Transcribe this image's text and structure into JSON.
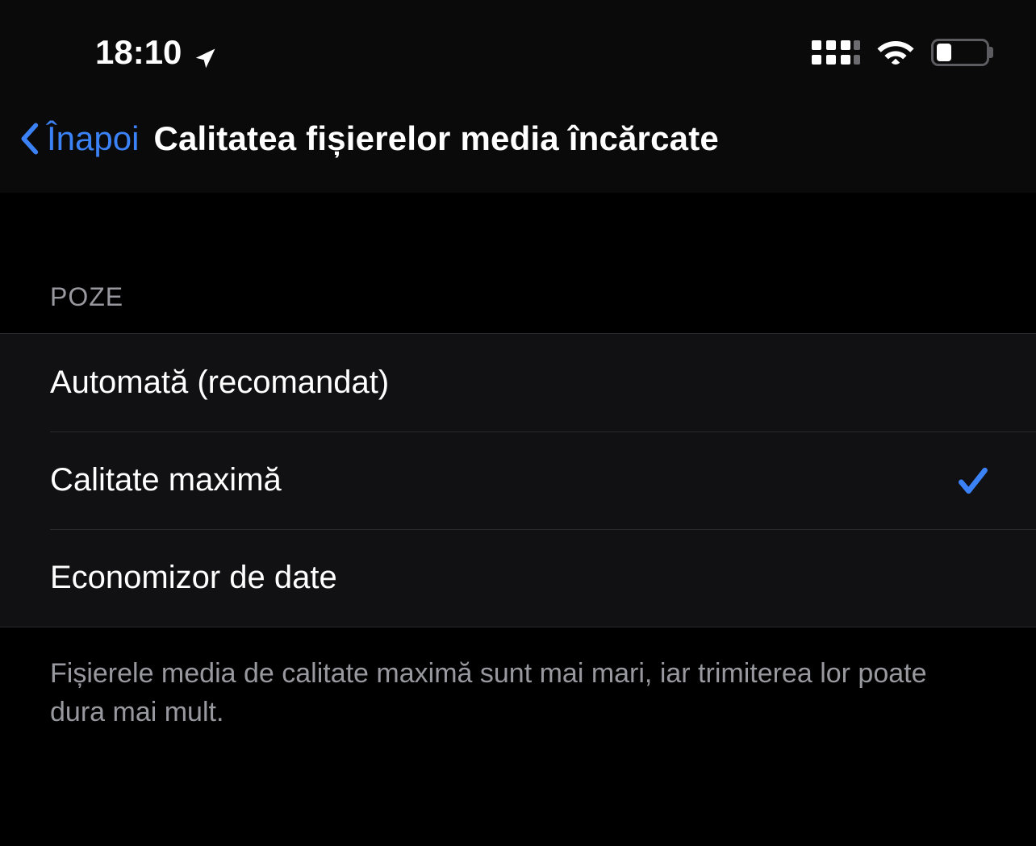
{
  "status_bar": {
    "time": "18:10"
  },
  "nav": {
    "back_label": "Înapoi",
    "title": "Calitatea fișierelor media încărcate"
  },
  "section": {
    "header": "POZE",
    "options": [
      {
        "label": "Automată (recomandat)",
        "selected": false
      },
      {
        "label": "Calitate maximă",
        "selected": true
      },
      {
        "label": "Economizor de date",
        "selected": false
      }
    ],
    "footer": "Fișierele media de calitate maximă sunt mai mari, iar trimiterea lor poate dura mai mult."
  }
}
